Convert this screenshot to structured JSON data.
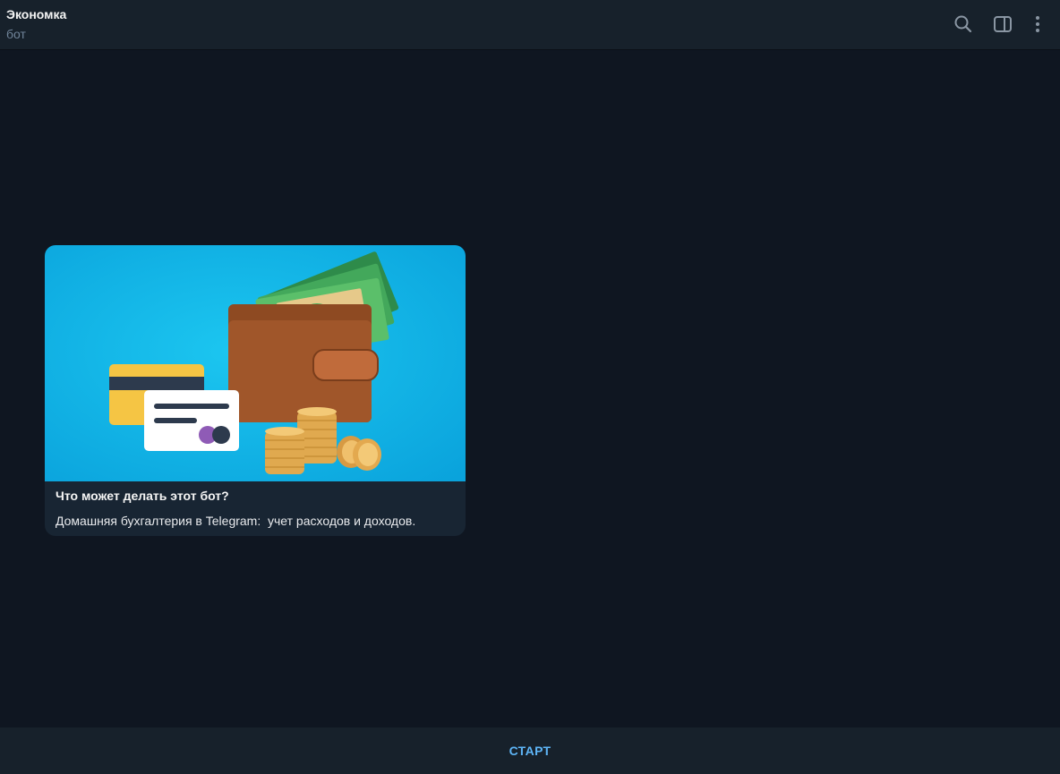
{
  "header": {
    "title": "Экономка",
    "subtitle": "бот",
    "icons": [
      "search-icon",
      "sidebar-toggle-icon",
      "more-vertical-icon"
    ]
  },
  "intro_card": {
    "title": "Что может делать этот бот?",
    "description": "Домашняя бухгалтерия в Telegram:  учет расходов и доходов.",
    "image": "wallet-cards-coins-illustration"
  },
  "bottom_bar": {
    "start_label": "СТАРТ"
  },
  "colors": {
    "background": "#0f1621",
    "panel": "#17212b",
    "card": "#182533",
    "accent": "#5eb5f7",
    "muted_text": "#708499",
    "image_bg": "#16b4e9"
  }
}
